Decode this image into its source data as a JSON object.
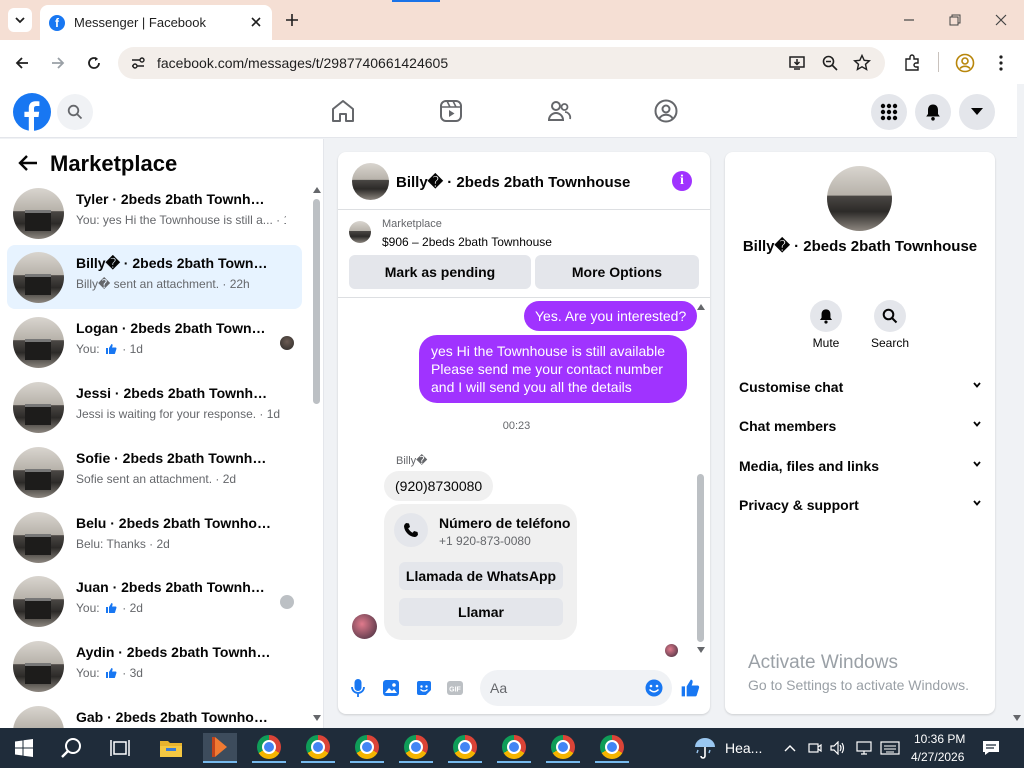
{
  "browser": {
    "tab_title": "Messenger | Facebook",
    "url": "facebook.com/messages/t/2987740661424605"
  },
  "sidebar": {
    "title": "Marketplace",
    "conversations": [
      {
        "name": "Tyler · 2beds 2bath Townhouse",
        "preview": "You: yes Hi the Townhouse is still a... · 1m",
        "like": false
      },
      {
        "name": "Billy� · 2beds 2bath Townhouse",
        "preview": "Billy� sent an attachment. · 22h",
        "like": false
      },
      {
        "name": "Logan · 2beds 2bath Townho...",
        "preview_prefix": "You: ",
        "preview_suffix": " · 1d",
        "like": true
      },
      {
        "name": "Jessi · 2beds 2bath Townhouse",
        "preview": "Jessi is waiting for your response. · 1d",
        "like": false
      },
      {
        "name": "Sofie · 2beds 2bath Townhouse",
        "preview": "Sofie sent an attachment. · 2d",
        "like": false
      },
      {
        "name": "Belu · 2beds 2bath Townhouse",
        "preview": "Belu: Thanks · 2d",
        "like": false
      },
      {
        "name": "Juan · 2beds 2bath Townhouse",
        "preview_prefix": "You: ",
        "preview_suffix": " · 2d",
        "like": true
      },
      {
        "name": "Aydin · 2beds 2bath Townhouse",
        "preview_prefix": "You: ",
        "preview_suffix": " · 3d",
        "like": true
      },
      {
        "name": "Gab · 2beds 2bath Townhouse",
        "preview": "",
        "like": false
      }
    ]
  },
  "chat": {
    "header_name": "Billy� · 2beds 2bath Townhouse",
    "listing_label": "Marketplace",
    "listing_price": "$906 – 2beds 2bath Townhouse",
    "mark_pending": "Mark as pending",
    "more_options": "More Options",
    "msg_out_1": "Yes. Are you interested?",
    "msg_out_2_lines": [
      "yes Hi the Townhouse is still available",
      "Please send me your contact number",
      "and I will send you all the details"
    ],
    "timestamp": "00:23",
    "sender_name": "Billy�",
    "msg_in_1": "(920)8730080",
    "card_title": "Número de teléfono",
    "card_number": "+1 920-873-0080",
    "card_btn_whatsapp": "Llamada de WhatsApp",
    "card_btn_call": "Llamar",
    "composer_placeholder": "Aa"
  },
  "info_panel": {
    "name": "Billy� · 2beds 2bath Townhouse",
    "mute_label": "Mute",
    "search_label": "Search",
    "rows": [
      "Customise chat",
      "Chat members",
      "Media, files and links",
      "Privacy & support"
    ]
  },
  "watermark": {
    "line1": "Activate Windows",
    "line2": "Go to Settings to activate Windows."
  },
  "taskbar": {
    "weather_text": "Hea...",
    "time": "10:36 PM",
    "date": "4/27/2026"
  },
  "colors": {
    "messenger_purple": "#a033ff",
    "facebook_blue": "#1877f2",
    "selected_row": "#e7f3ff"
  }
}
